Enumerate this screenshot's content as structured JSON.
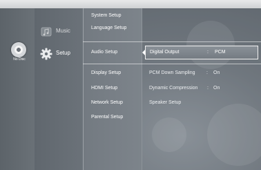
{
  "disc_status": {
    "label": "No Disc"
  },
  "categories": [
    {
      "label": "Music",
      "icon": "music-note-icon",
      "selected": false
    },
    {
      "label": "Setup",
      "icon": "gear-icon",
      "selected": true
    }
  ],
  "setup_menu": [
    "System Setup",
    "Language Setup",
    "Audio Setup",
    "Display Setup",
    "HDMI Setup",
    "Network Setup",
    "Parental Setup"
  ],
  "audio_options": [
    {
      "label": "Digital Output",
      "separator": ":",
      "value": "PCM",
      "selected": true
    },
    {
      "label": "PCM Down Sampling",
      "separator": ":",
      "value": "On",
      "selected": false
    },
    {
      "label": "Dynamic Compression",
      "separator": ":",
      "value": "On",
      "selected": false
    },
    {
      "label": "Speaker Setup",
      "separator": "",
      "value": "",
      "selected": false
    }
  ],
  "colors": {
    "text": "#ffffff",
    "selection_border": "#f2f2f2"
  }
}
